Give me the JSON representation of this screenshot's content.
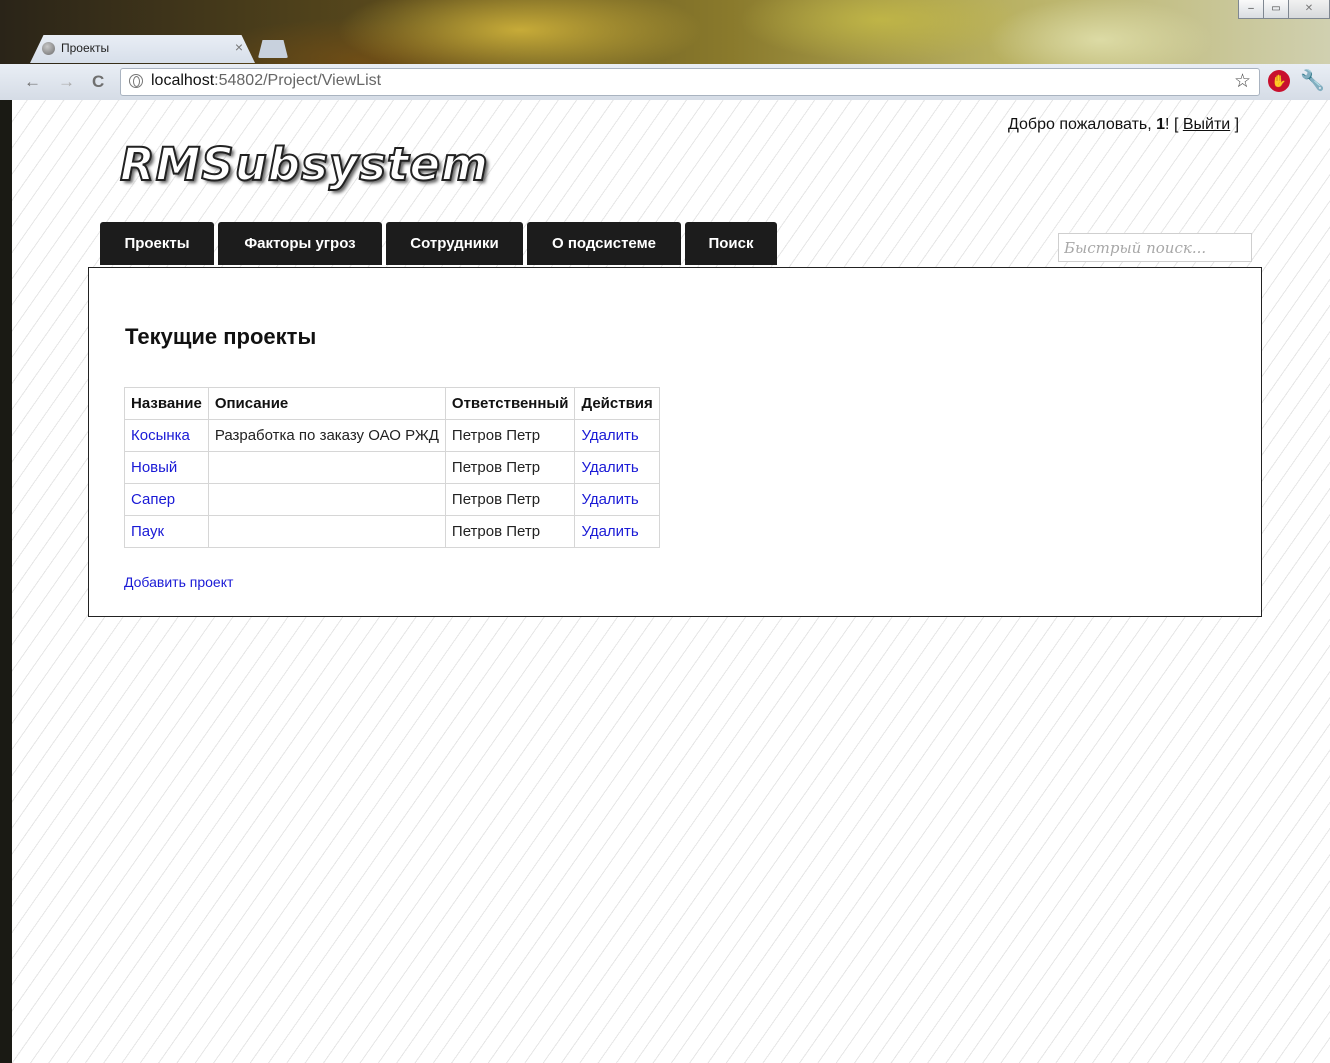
{
  "browser": {
    "tab_title": "Проекты",
    "tab_close": "×",
    "url_host": "localhost",
    "url_rest": ":54802/Project/ViewList",
    "back_glyph": "←",
    "forward_glyph": "→",
    "reload_glyph": "C",
    "star_glyph": "☆",
    "wrench_glyph": "🔧",
    "minimize_glyph": "–",
    "maximize_glyph": "▭",
    "close_glyph": "✕"
  },
  "header": {
    "welcome_prefix": "Добро пожаловать, ",
    "username": "1",
    "welcome_suffix": "! [ ",
    "logout": "Выйти",
    "bracket_close": " ]",
    "site_title": "RMSubsystem"
  },
  "menu": {
    "items": [
      {
        "label": "Проекты"
      },
      {
        "label": "Факторы угроз"
      },
      {
        "label": "Сотрудники"
      },
      {
        "label": "О подсистеме"
      },
      {
        "label": "Поиск"
      }
    ],
    "search_placeholder": "Быстрый поиск..."
  },
  "main": {
    "heading": "Текущие проекты",
    "columns": [
      "Название",
      "Описание",
      "Ответственный",
      "Действия"
    ],
    "rows": [
      {
        "name": "Косынка",
        "description": "Разработка по заказу ОАО РЖД",
        "owner": "Петров Петр",
        "action": "Удалить"
      },
      {
        "name": "Новый",
        "description": "",
        "owner": "Петров Петр",
        "action": "Удалить"
      },
      {
        "name": "Сапер",
        "description": "",
        "owner": "Петров Петр",
        "action": "Удалить"
      },
      {
        "name": "Паук",
        "description": "",
        "owner": "Петров Петр",
        "action": "Удалить"
      }
    ],
    "add_link": "Добавить проект"
  }
}
